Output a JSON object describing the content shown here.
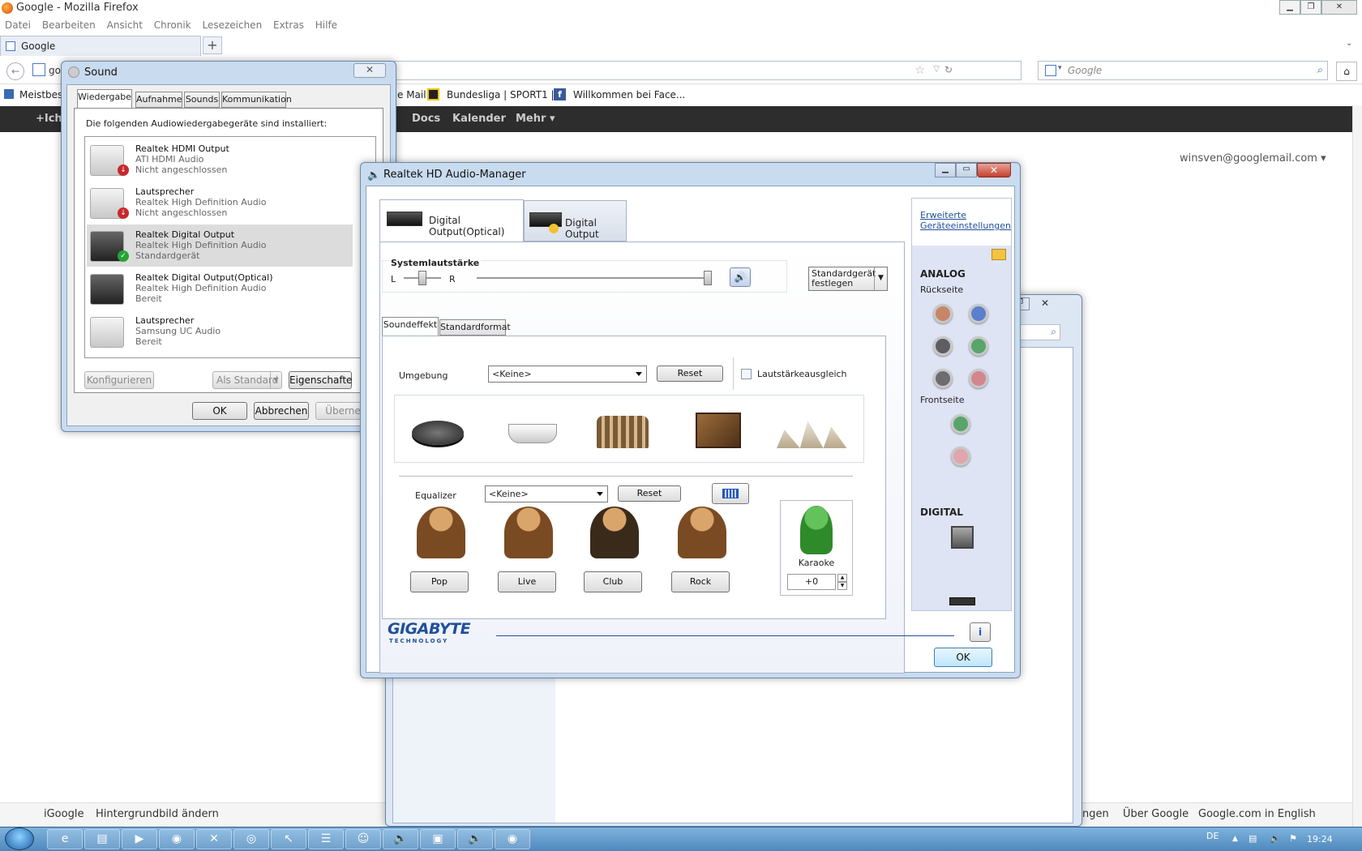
{
  "firefox": {
    "title": "Google - Mozilla Firefox",
    "menu": [
      "Datei",
      "Bearbeiten",
      "Ansicht",
      "Chronik",
      "Lesezeichen",
      "Extras",
      "Hilfe"
    ],
    "tab_label": "Google",
    "url_prefix": "go",
    "search_placeholder": "Google",
    "bookmarks": [
      "Meistbesu",
      "e Mail",
      "Bundesliga | SPORT1 |...",
      "Willkommen bei Face..."
    ],
    "gbar": [
      "+Ich",
      "Docs",
      "Kalender",
      "Mehr ▾"
    ],
    "user_email": "winsven@googlemail.com ▾",
    "footer_left": [
      "iGoogle",
      "Hintergrundbild ändern"
    ],
    "footer_right": [
      "ngen",
      "Über Google",
      "Google.com in English"
    ]
  },
  "sound": {
    "title": "Sound",
    "tabs": [
      "Wiedergabe",
      "Aufnahme",
      "Sounds",
      "Kommunikation"
    ],
    "intro": "Die folgenden Audiowiedergabegeräte sind installiert:",
    "devices": [
      {
        "name": "Realtek HDMI Output",
        "driver": "ATI HDMI Audio",
        "status": "Nicht angeschlossen"
      },
      {
        "name": "Lautsprecher",
        "driver": "Realtek High Definition Audio",
        "status": "Nicht angeschlossen"
      },
      {
        "name": "Realtek Digital Output",
        "driver": "Realtek High Definition Audio",
        "status": "Standardgerät"
      },
      {
        "name": "Realtek Digital Output(Optical)",
        "driver": "Realtek High Definition Audio",
        "status": "Bereit"
      },
      {
        "name": "Lautsprecher",
        "driver": "Samsung UC Audio",
        "status": "Bereit"
      }
    ],
    "configure": "Konfigurieren",
    "set_default": "Als Standard",
    "properties": "Eigenschafte",
    "ok": "OK",
    "cancel": "Abbrechen",
    "apply": "Überne"
  },
  "realtek": {
    "title": "Realtek HD Audio-Manager",
    "tabs": [
      "Digital Output(Optical)",
      "Digital Output"
    ],
    "advanced_link_1": "Erweiterte",
    "advanced_link_2": "Geräteeinstellungen",
    "system_volume": "Systemlautstärke",
    "left": "L",
    "right": "R",
    "set_default_1": "Standardgerät",
    "set_default_2": "festlegen",
    "subtabs": [
      "Soundeffekt",
      "Standardformat"
    ],
    "environment_label": "Umgebung",
    "environment_value": "<Keine>",
    "reset": "Reset",
    "loudness": "Lautstärkeausgleich",
    "equalizer_label": "Equalizer",
    "equalizer_value": "<Keine>",
    "eq_presets": [
      "Pop",
      "Live",
      "Club",
      "Rock"
    ],
    "karaoke": "Karaoke",
    "karaoke_value": "+0",
    "analog": "ANALOG",
    "rear": "Rückseite",
    "front": "Frontseite",
    "digital": "DIGITAL",
    "brand": "GIGABYTE",
    "brand_sub": "TECHNOLOGY",
    "ok": "OK",
    "colors": {
      "accent": "#1f4f9a",
      "frame": "#c9dbef"
    }
  },
  "taskbar": {
    "lang": "DE",
    "time": "19:24"
  }
}
